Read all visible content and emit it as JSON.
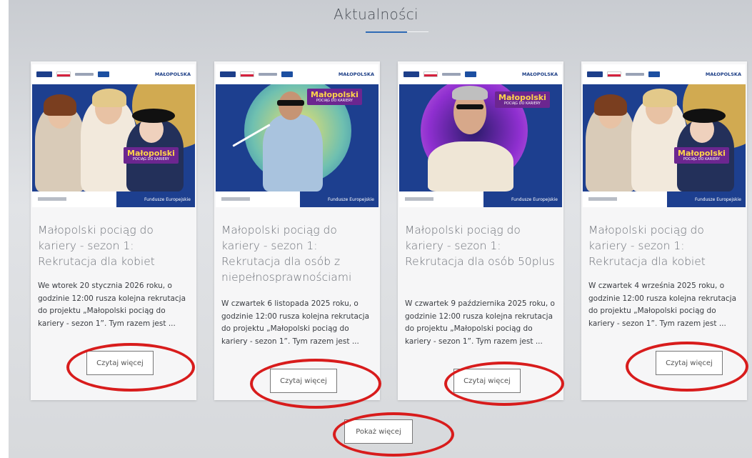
{
  "section_title": "Aktualności",
  "cards": [
    {
      "logo_text": "MAŁOPOLSKA",
      "badge_main": "Małopolski",
      "badge_sub": "POCIĄG DO KARIERY",
      "footer_text": "Fundusze Europejskie",
      "title": "Małopolski pociąg do kariery - sezon 1: Rekrutacja dla kobiet",
      "excerpt": "We wtorek 20 stycznia 2026 roku, o godzinie 12:00 rusza kolejna rekrutacja do projektu „Małopolski pociąg do kariery - sezon 1”. Tym razem jest ...",
      "button": "Czytaj więcej"
    },
    {
      "logo_text": "MAŁOPOLSKA",
      "badge_main": "Małopolski",
      "badge_sub": "POCIĄG DO KARIERY",
      "footer_text": "Fundusze Europejskie",
      "title": "Małopolski pociąg do kariery - sezon 1: Rekrutacja dla osób z niepełnosprawnościami",
      "excerpt": "W czwartek 6 listopada 2025 roku, o godzinie 12:00 rusza kolejna rekrutacja do projektu „Małopolski pociąg do kariery - sezon 1”. Tym razem jest ...",
      "button": "Czytaj więcej"
    },
    {
      "logo_text": "MAŁOPOLSKA",
      "badge_main": "Małopolski",
      "badge_sub": "POCIĄG DO KARIERY",
      "footer_text": "Fundusze Europejskie",
      "title": "Małopolski pociąg do kariery - sezon 1: Rekrutacja dla osób 50plus",
      "excerpt": "W czwartek 9 października 2025 roku, o godzinie 12:00 rusza kolejna rekrutacja do projektu „Małopolski pociąg do kariery - sezon 1”. Tym razem jest ...",
      "button": "Czytaj więcej"
    },
    {
      "logo_text": "MAŁOPOLSKA",
      "badge_main": "Małopolski",
      "badge_sub": "POCIĄG DO KARIERY",
      "footer_text": "Fundusze Europejskie",
      "title": "Małopolski pociąg do kariery - sezon 1: Rekrutacja dla kobiet",
      "excerpt": "W czwartek 4 września 2025 roku, o godzinie 12:00 rusza kolejna rekrutacja do projektu „Małopolski pociąg do kariery - sezon 1”. Tym razem jest ...",
      "button": "Czytaj więcej"
    }
  ],
  "show_more_button": "Pokaż więcej",
  "colors": {
    "accent_line": "#2f6ab5",
    "highlight_ring": "#d81c1c",
    "badge_bg": "#6c2690",
    "badge_text": "#ffd54a",
    "banner_blue": "#1d3f8f"
  }
}
